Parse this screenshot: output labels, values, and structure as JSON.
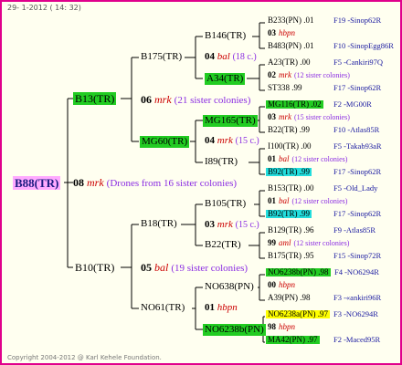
{
  "header": {
    "date": "29-  1-2012 ( 14: 32)"
  },
  "footer": {
    "copyright": "Copyright 2004-2012 @ Karl Kehele Foundation."
  },
  "colors": {
    "green": "#22cc22",
    "cyan": "#22dddd",
    "yellow": "#ffff00",
    "pink": "#ffaaff",
    "border": "#e0008c"
  },
  "root": {
    "name": "B88(TR)"
  },
  "gen1": {
    "num": "08",
    "code": "mrk",
    "note": "(Drones from 16 sister colonies)",
    "upper": "B13(TR)",
    "lower": "B10(TR)"
  },
  "gen2": {
    "upper": {
      "num": "06",
      "code": "mrk",
      "note": "(21 sister colonies)",
      "a": "B175(TR)",
      "b": "MG60(TR)"
    },
    "lower": {
      "num": "05",
      "code": "bal",
      "note": "(19 sister colonies)",
      "a": "B18(TR)",
      "b": "NO61(TR)"
    }
  },
  "gen3": [
    {
      "num": "04",
      "code": "bal",
      "note": "(18 c.)",
      "a": "B146(TR)",
      "b": "A34(TR)"
    },
    {
      "num": "04",
      "code": "mrk",
      "note": "(15 c.)",
      "a": "MG165(TR)",
      "b": "I89(TR)"
    },
    {
      "num": "03",
      "code": "mrk",
      "note": "(15 c.)",
      "a": "B105(TR)",
      "b": "B22(TR)"
    },
    {
      "num": "01",
      "code": "hbpn",
      "note": "",
      "a": "NO638(PN)",
      "b": "NO6238b(PN)"
    }
  ],
  "gen4": [
    {
      "a": "B233(PN) .01",
      "a_info": "F19 -Sinop62R",
      "num": "03",
      "code": "hbpn",
      "note": "",
      "b": "B483(PN) .01",
      "b_info": "F10 -SinopEgg86R"
    },
    {
      "a": "A23(TR) .00",
      "a_info": "F5 -Cankiri97Q",
      "num": "02",
      "code": "mrk",
      "note": "(12 sister colonies)",
      "b": "ST338 .99",
      "b_info": "F17 -Sinop62R"
    },
    {
      "a": "MG116(TR) .02",
      "a_info": "F2 -MG00R",
      "num": "03",
      "code": "mrk",
      "note": "(15 sister colonies)",
      "b": "B22(TR) .99",
      "b_info": "F10 -Atlas85R"
    },
    {
      "a": "I100(TR) .00",
      "a_info": "F5 -Takab93aR",
      "num": "01",
      "code": "bal",
      "note": "(12 sister colonies)",
      "b": "B92(TR) .99",
      "b_info": "F17 -Sinop62R"
    },
    {
      "a": "B153(TR) .00",
      "a_info": "F5 -Old_Lady",
      "num": "01",
      "code": "bal",
      "note": "(12 sister colonies)",
      "b": "B92(TR) .99",
      "b_info": "F17 -Sinop62R"
    },
    {
      "a": "B129(TR) .96",
      "a_info": "F9 -Atlas85R",
      "num": "99",
      "code": "aml",
      "note": "(12 sister colonies)",
      "b": "B175(TR) .95",
      "b_info": "F15 -Sinop72R"
    },
    {
      "a": "NO6238b(PN) .98",
      "a_info": "F4 -NO6294R",
      "num": "00",
      "code": "hbpn",
      "note": "",
      "b": "A39(PN) .98",
      "b_info": "F3 -«ankiri96R"
    },
    {
      "a": "NO6238a(PN) .97",
      "a_info": "F3 -NO6294R",
      "num": "98",
      "code": "hbpn",
      "note": "",
      "b": "MA42(PN) .97",
      "b_info": "F2 -Maced95R"
    }
  ]
}
